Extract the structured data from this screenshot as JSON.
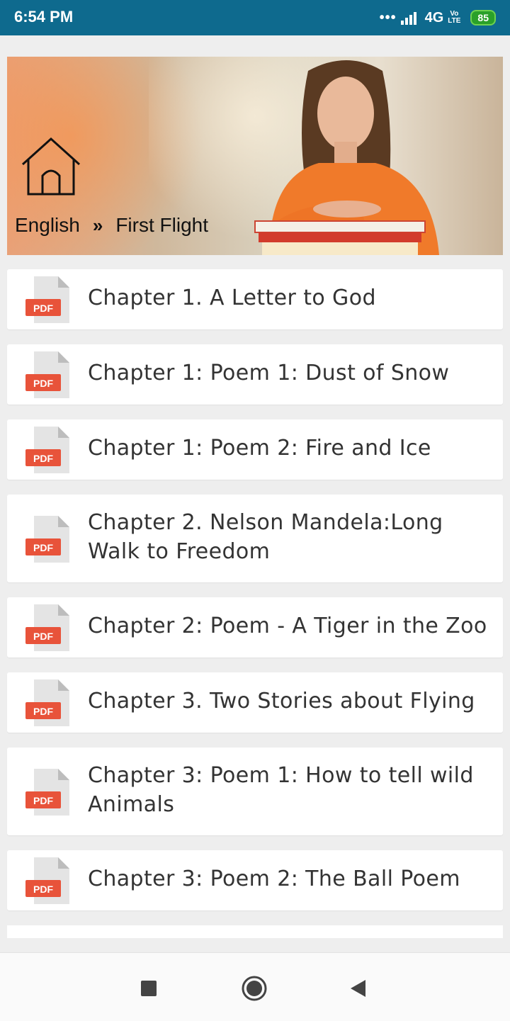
{
  "status_bar": {
    "time": "6:54 PM",
    "dots": "•••",
    "network": "4G",
    "volte": "Vo\nLTE",
    "battery": "85"
  },
  "hero": {
    "breadcrumb": {
      "subject": "English",
      "separator": "»",
      "book": "First Flight"
    }
  },
  "chapters": [
    {
      "label": "Chapter 1. A Letter to God",
      "badge": "PDF"
    },
    {
      "label": "Chapter 1: Poem 1: Dust of Snow",
      "badge": "PDF"
    },
    {
      "label": "Chapter 1: Poem 2: Fire and Ice",
      "badge": "PDF"
    },
    {
      "label": "Chapter 2. Nelson Mandela:Long Walk to Freedom",
      "badge": "PDF"
    },
    {
      "label": "Chapter 2: Poem - A Tiger in the Zoo",
      "badge": "PDF"
    },
    {
      "label": "Chapter 3. Two Stories about Flying",
      "badge": "PDF"
    },
    {
      "label": "Chapter 3: Poem 1: How to tell wild Animals",
      "badge": "PDF"
    },
    {
      "label": "Chapter 3: Poem 2: The Ball Poem",
      "badge": "PDF"
    }
  ],
  "navbar": {
    "recents_icon": "square-icon",
    "home_icon": "circle-icon",
    "back_icon": "triangle-back-icon"
  },
  "colors": {
    "status_bar": "#0e6a8e",
    "pdf_badge": "#e8533a"
  }
}
